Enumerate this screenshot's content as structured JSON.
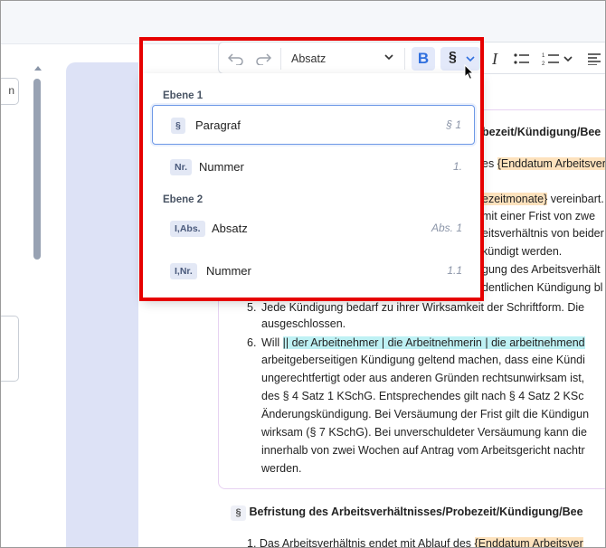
{
  "left_panel": {
    "input_fragment": "n"
  },
  "toolbar": {
    "undo_icon": "undo-icon",
    "redo_icon": "redo-icon",
    "block_format": "Absatz",
    "bold_label": "B",
    "paragraph_label": "§",
    "italic_label": "I",
    "italic_icon": "italic-icon",
    "bullet_list_icon": "bullet-list-icon",
    "numbered_list_icon": "numbered-list-icon",
    "align_icon": "align-icon"
  },
  "dropdown": {
    "groups": [
      {
        "title": "Ebene 1",
        "items": [
          {
            "badge": "§",
            "label": "Paragraf",
            "shortcut": "§ 1",
            "selected": true
          },
          {
            "badge": "Nr.",
            "label": "Nummer",
            "shortcut": "1."
          }
        ]
      },
      {
        "title": "Ebene 2",
        "items": [
          {
            "badge": "I,Abs.",
            "label": "Absatz",
            "shortcut": "Abs. 1"
          },
          {
            "badge": "I,Nr.",
            "label": "Nummer",
            "shortcut": "1.1"
          }
        ]
      }
    ]
  },
  "document": {
    "heading_partial": "bezeit/Kündigung/Bee",
    "placeholder_end_date": "{Enddatum Arbeitsvert",
    "placeholder_probation": "ezeitmonate}",
    "text_vereinbart": " vereinbart.",
    "frag_frist": "mit einer Frist von zwe",
    "frag_arbeits": "eitsverhältnis von beider",
    "frag_kuendigt": "kündigt werden.",
    "frag_gung": "gung des Arbeitsverhält",
    "frag_dentlichen": "dentlichen Kündigung bl",
    "item5_num": "5.",
    "item5_line1": "Jede Kündigung bedarf zu ihrer Wirksamkeit der Schriftform. Die",
    "item5_line2": "ausgeschlossen.",
    "item6_num": "6.",
    "item6_prefix": "Will ",
    "item6_highlight": "|| der Arbeitnehmer | die Arbeitnehmerin | die arbeitnehmend",
    "item6_lines": [
      "arbeitgeberseitigen Kündigung geltend machen, dass eine Kündi",
      "ungerechtfertigt oder aus anderen Gründen rechtsunwirksam ist,",
      "des § 4 Satz 1 KSchG. Entsprechendes gilt nach § 4 Satz 2 KSc",
      "Änderungskündigung. Bei Versäumung der Frist gilt die Kündigun",
      "wirksam (§ 7 KSchG). Bei unverschuldeter Versäumung kann die",
      "innerhalb von zwei Wochen auf Antrag vom Arbeitsgericht nachtr",
      "werden."
    ],
    "section2_badge": "§",
    "section2_heading": "Befristung des Arbeitsverhältnisses/Probezeit/Kündigung/Bee",
    "section2_item1": "1. Das Arbeitsverhältnis endet mit Ablauf des",
    "section2_placeholder": "{Enddatum Arbeitsver"
  },
  "colors": {
    "highlight_box": "#e60000",
    "accent_blue": "#2f6fde",
    "placeholder_orange": "#fde2bd",
    "choice_cyan": "#bff1f4"
  }
}
